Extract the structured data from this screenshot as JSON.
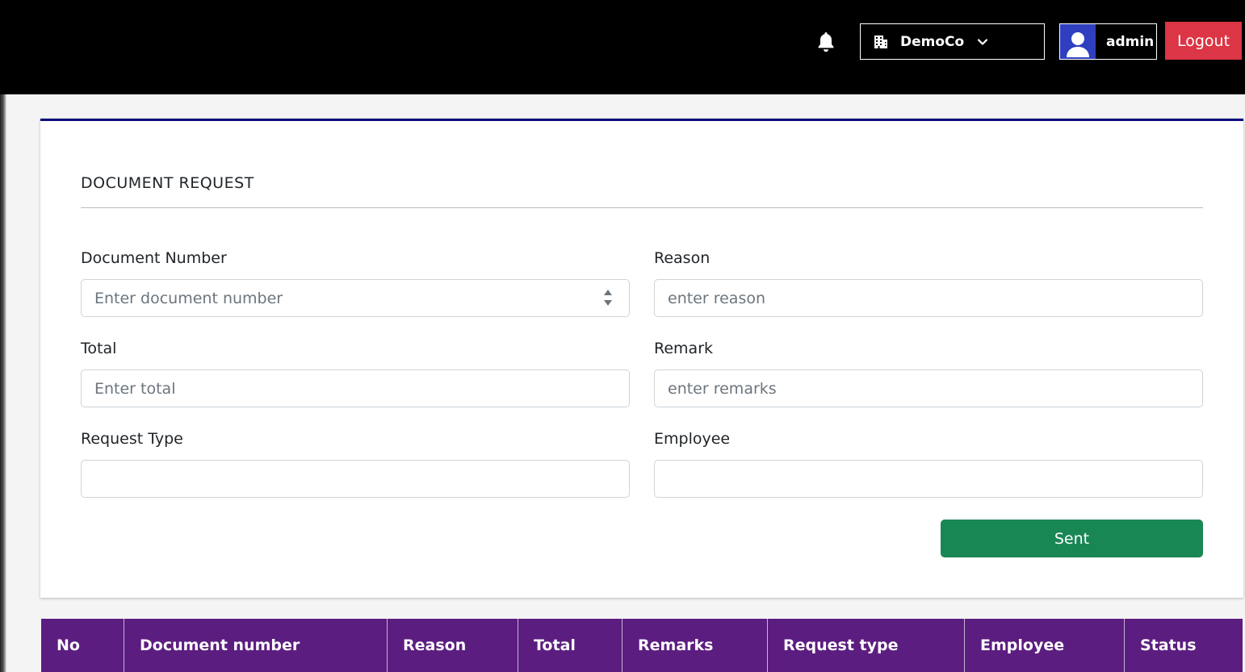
{
  "header": {
    "company_name": "DemoCo",
    "user_name": "admin",
    "logout_label": "Logout"
  },
  "form": {
    "title": "DOCUMENT REQUEST",
    "document_number": {
      "label": "Document Number",
      "placeholder": "Enter document number",
      "value": ""
    },
    "reason": {
      "label": "Reason",
      "placeholder": "enter reason",
      "value": ""
    },
    "total": {
      "label": "Total",
      "placeholder": "Enter total",
      "value": ""
    },
    "remark": {
      "label": "Remark",
      "placeholder": "enter remarks",
      "value": ""
    },
    "request_type": {
      "label": "Request Type",
      "placeholder": "",
      "value": ""
    },
    "employee": {
      "label": "Employee",
      "placeholder": "",
      "value": ""
    },
    "submit_label": "Sent"
  },
  "table": {
    "columns": [
      "No",
      "Document number",
      "Reason",
      "Total",
      "Remarks",
      "Request type",
      "Employee",
      "Status"
    ]
  },
  "icons": {
    "bell": "bell-icon",
    "company": "building-icon",
    "dropdown": "chevron-down-icon",
    "avatar": "user-icon"
  },
  "colors": {
    "topbar": "#000000",
    "logout": "#dc3545",
    "card_accent": "#08087a",
    "submit": "#198754",
    "table_header": "#5c1d80",
    "avatar": "#2f3fbf"
  }
}
